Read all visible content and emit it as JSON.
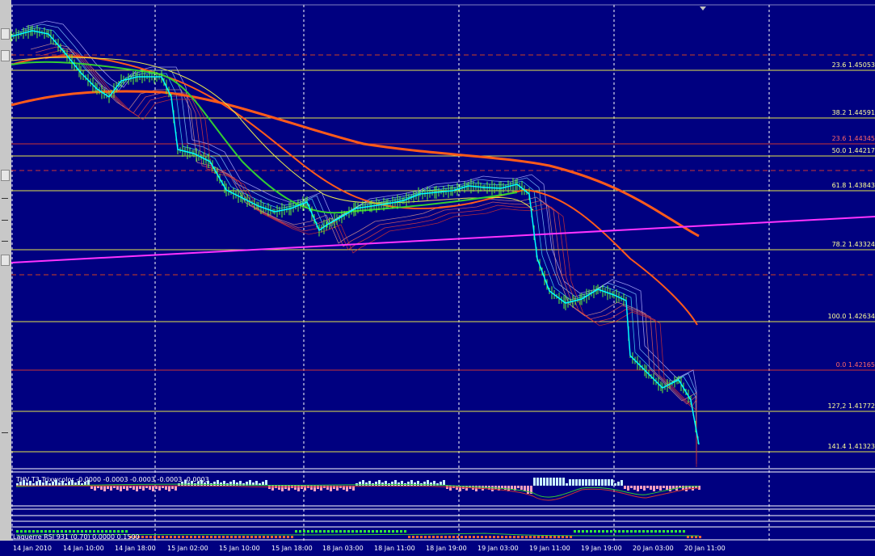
{
  "colors": {
    "background": "#000080",
    "candle": "#66ff33",
    "fib_line": "#e6e64d",
    "fib_red": "#cc3333",
    "ema_fast": "#00ffff",
    "ema_slow": "#ff5a1a",
    "trendline": "#ff33ff"
  },
  "fib_levels": [
    {
      "label": "23.6 1.45053",
      "color": "yellow"
    },
    {
      "label": "38.2 1.44591",
      "color": "yellow"
    },
    {
      "label": "23.6 1.44345",
      "color": "red"
    },
    {
      "label": "50.0 1.44217",
      "color": "yellow"
    },
    {
      "label": "61.8 1.43843",
      "color": "yellow"
    },
    {
      "label": "78.2 1.43324",
      "color": "yellow"
    },
    {
      "label": "100.0 1.42634",
      "color": "yellow"
    },
    {
      "label": "0.0 1.42165",
      "color": "red"
    },
    {
      "label": "127,2 1.41772",
      "color": "yellow"
    },
    {
      "label": "141.4 1.41323",
      "color": "yellow"
    }
  ],
  "indicators": {
    "trix_label": "THV T3 Trixwcolor -0.0000 -0.0003 -0.0003 -0.0003 -0.0003",
    "laguerre_label": "Laguerre RSI 931 (0.70) 0.0000 0.1500"
  },
  "time_axis": [
    "14 Jan 2010",
    "14 Jan 10:00",
    "14 Jan 18:00",
    "15 Jan 02:00",
    "15 Jan 10:00",
    "15 Jan 18:00",
    "18 Jan 03:00",
    "18 Jan 11:00",
    "18 Jan 19:00",
    "19 Jan 03:00",
    "19 Jan 11:00",
    "19 Jan 19:00",
    "20 Jan 03:00",
    "20 Jan 11:00"
  ]
}
